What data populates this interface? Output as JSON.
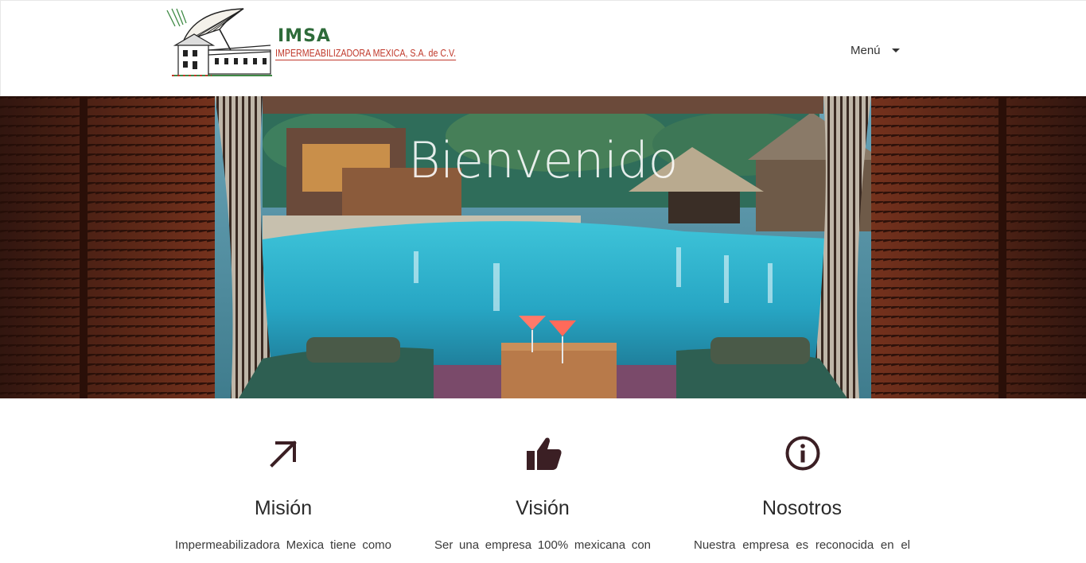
{
  "header": {
    "logo": {
      "brand": "IMSA",
      "company": "IMPERMEABILIZADORA MEXICA, S.A. de C.V."
    },
    "menu_label": "Menú"
  },
  "hero": {
    "title": "Bienvenido"
  },
  "features": [
    {
      "icon": "arrow-up-right-icon",
      "title": "Misión",
      "text": "Impermeabilizadora Mexica tiene como"
    },
    {
      "icon": "thumbs-up-icon",
      "title": "Visión",
      "text": "Ser una empresa 100% mexicana con"
    },
    {
      "icon": "info-icon",
      "title": "Nosotros",
      "text": "Nuestra empresa es reconocida en el"
    }
  ],
  "colors": {
    "icon": "#3b1f24",
    "logo_green": "#2e6b3a",
    "logo_red": "#c0392b"
  }
}
